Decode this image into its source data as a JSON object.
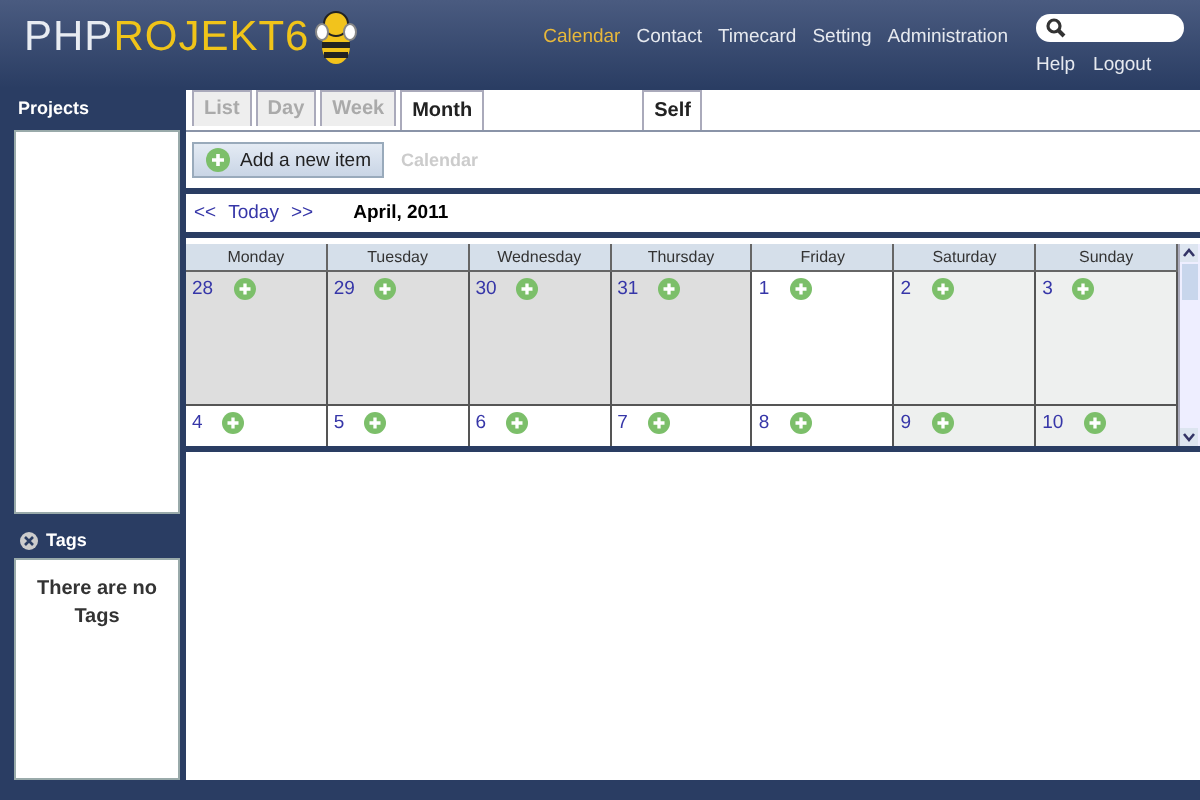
{
  "logo": {
    "prefix": "PHP",
    "name": "ROJEKT6"
  },
  "nav": [
    {
      "label": "Calendar",
      "selected": true
    },
    {
      "label": "Contact",
      "selected": false
    },
    {
      "label": "Timecard",
      "selected": false
    },
    {
      "label": "Setting",
      "selected": false
    },
    {
      "label": "Administration",
      "selected": false
    }
  ],
  "user_links": [
    "Help",
    "Logout"
  ],
  "sidebar": {
    "projects_title": "Projects",
    "tags_title": "Tags",
    "tags_empty": "There are no Tags"
  },
  "view_tabs": [
    {
      "label": "List",
      "selected": false
    },
    {
      "label": "Day",
      "selected": false
    },
    {
      "label": "Week",
      "selected": false
    },
    {
      "label": "Month",
      "selected": true
    }
  ],
  "user_tabs": [
    {
      "label": "Self",
      "selected": true
    }
  ],
  "toolbar": {
    "add_button": "Add a new item",
    "breadcrumb": "Calendar"
  },
  "date_nav": {
    "prev": "<<",
    "today": "Today",
    "next": ">>",
    "title": "April, 2011"
  },
  "calendar": {
    "weekdays": [
      "Monday",
      "Tuesday",
      "Wednesday",
      "Thursday",
      "Friday",
      "Saturday",
      "Sunday"
    ],
    "weeks": [
      [
        {
          "day": "28",
          "kind": "outside"
        },
        {
          "day": "29",
          "kind": "outside"
        },
        {
          "day": "30",
          "kind": "outside"
        },
        {
          "day": "31",
          "kind": "outside"
        },
        {
          "day": "1",
          "kind": "weekday"
        },
        {
          "day": "2",
          "kind": "weekend"
        },
        {
          "day": "3",
          "kind": "weekend"
        }
      ],
      [
        {
          "day": "4",
          "kind": "weekday"
        },
        {
          "day": "5",
          "kind": "weekday"
        },
        {
          "day": "6",
          "kind": "weekday"
        },
        {
          "day": "7",
          "kind": "weekday"
        },
        {
          "day": "8",
          "kind": "weekday"
        },
        {
          "day": "9",
          "kind": "weekend"
        },
        {
          "day": "10",
          "kind": "weekend"
        }
      ]
    ]
  }
}
